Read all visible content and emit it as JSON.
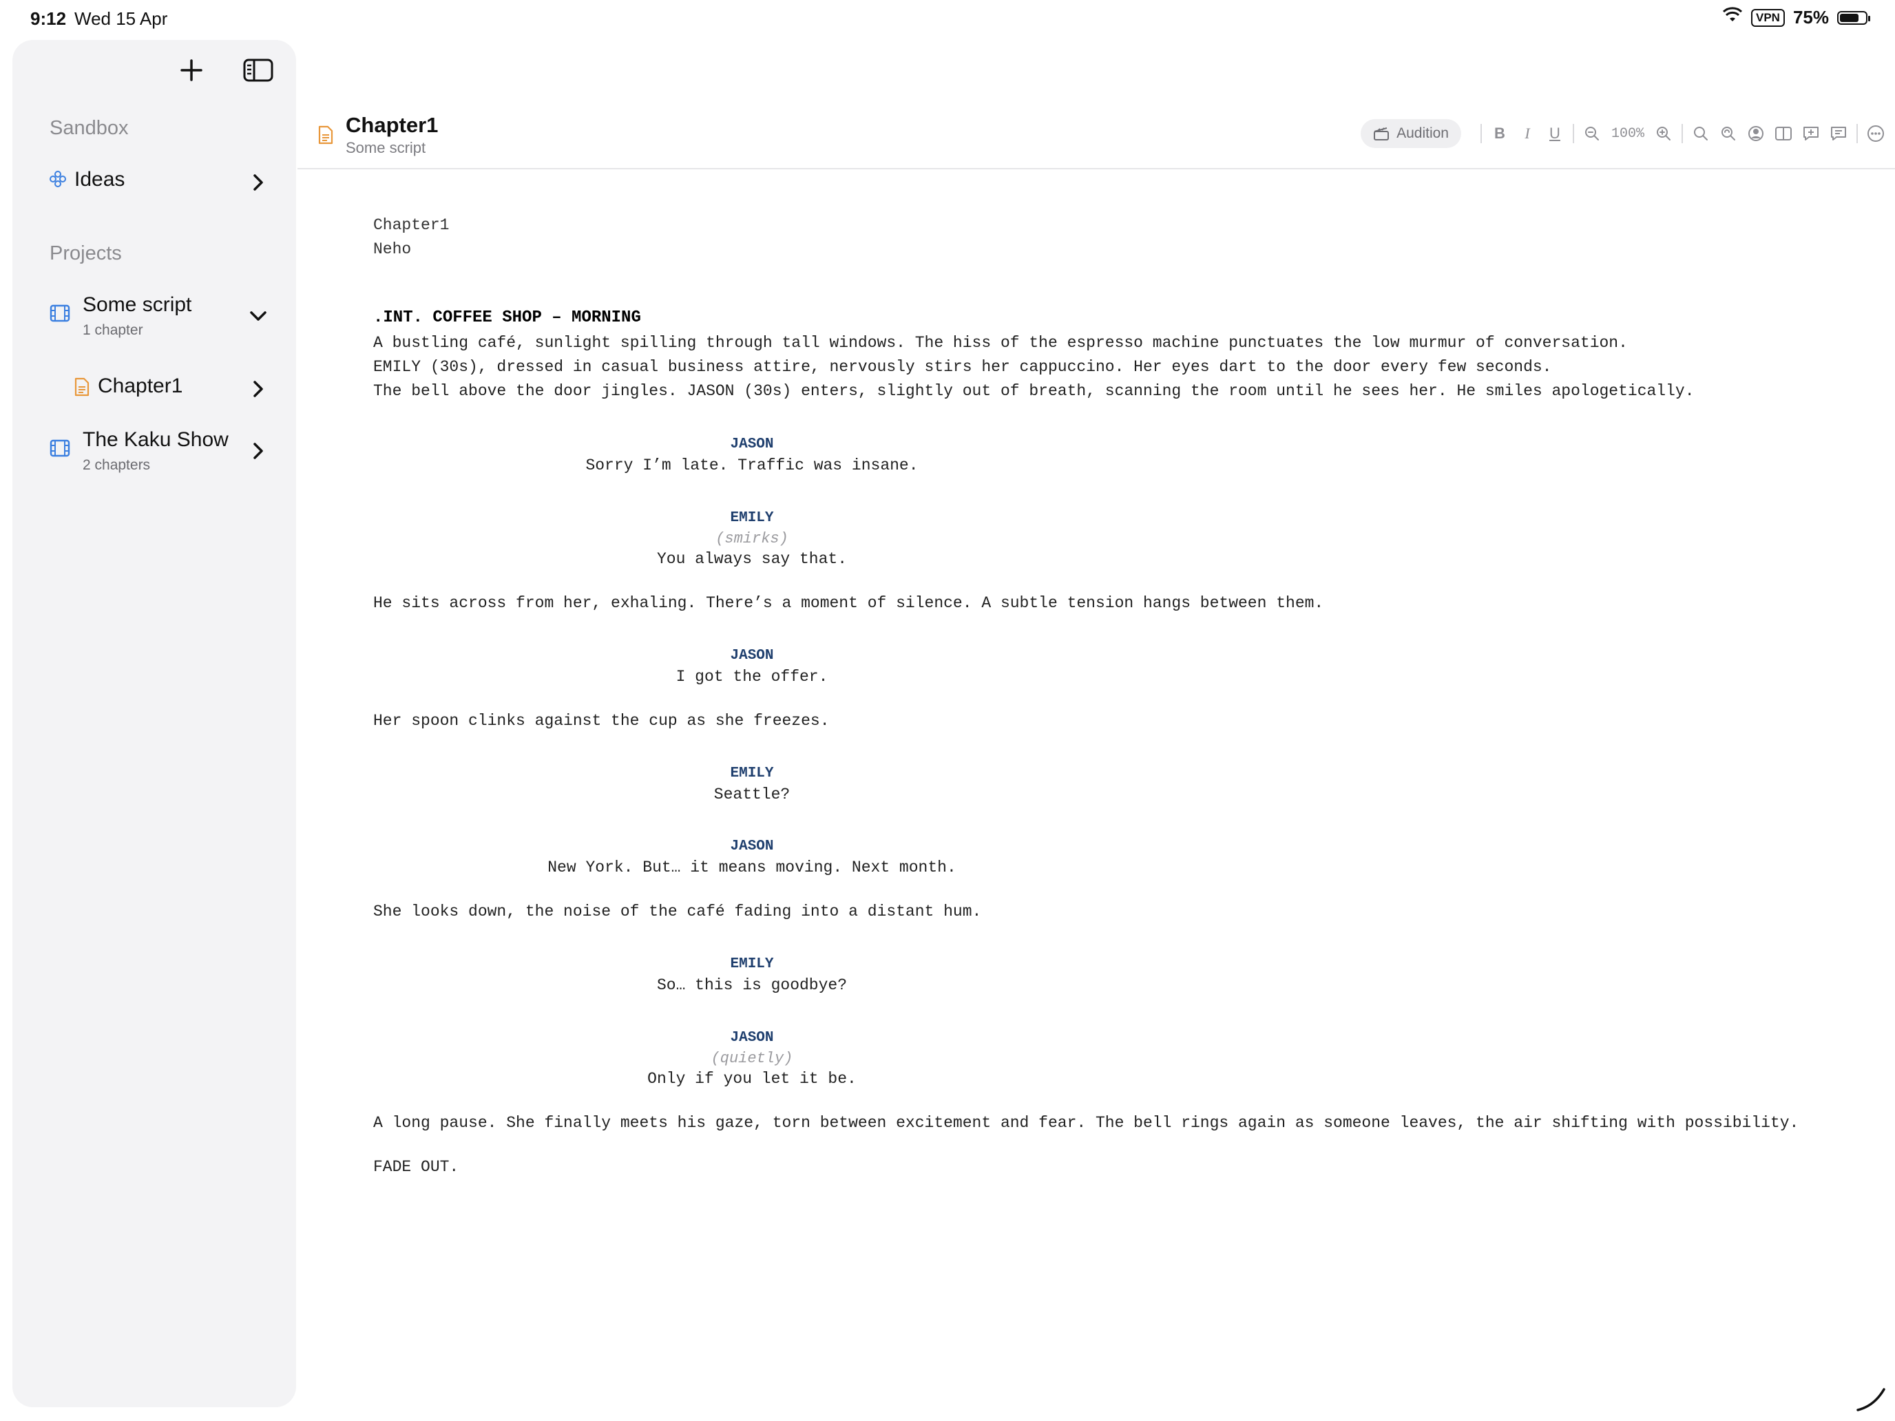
{
  "status_bar": {
    "time": "9:12",
    "date": "Wed 15 Apr",
    "vpn": "VPN",
    "battery": "75%",
    "battery_level": 0.75
  },
  "sidebar": {
    "sandbox_title": "Sandbox",
    "ideas_label": "Ideas",
    "projects_title": "Projects",
    "projects": [
      {
        "name": "Some script",
        "sub": "1 chapter",
        "chapter": "Chapter1"
      },
      {
        "name": "The Kaku Show",
        "sub": "2 chapters"
      }
    ]
  },
  "document": {
    "title": "Chapter1",
    "subtitle": "Some script"
  },
  "toolbar": {
    "audition_label": "Audition",
    "bold": "B",
    "italic": "I",
    "underline": "U",
    "zoom": "100%"
  },
  "script": {
    "title_lines": [
      "Chapter1",
      "Neho"
    ],
    "scene_heading": ".INT. COFFEE SHOP – MORNING",
    "action1": [
      "A bustling café, sunlight spilling through tall windows. The hiss of the espresso machine punctuates the low murmur of conversation.",
      "EMILY (30s), dressed in casual business attire, nervously stirs her cappuccino. Her eyes dart to the door every few seconds.",
      "The bell above the door jingles. JASON (30s) enters, slightly out of breath, scanning the room until he sees her. He smiles apologetically."
    ],
    "d1_char": "JASON",
    "d1_line": "Sorry I’m late. Traffic was insane.",
    "d2_char": "EMILY",
    "d2_paren": "(smirks)",
    "d2_line": "You always say that.",
    "action2": "He sits across from her, exhaling. There’s a moment of silence. A subtle tension hangs between them.",
    "d3_char": "JASON",
    "d3_line": "I got the offer.",
    "action3": "Her spoon clinks against the cup as she freezes.",
    "d4_char": "EMILY",
    "d4_line": "Seattle?",
    "d5_char": "JASON",
    "d5_line": "New York. But… it means moving. Next month.",
    "action4": "She looks down, the noise of the café fading into a distant hum.",
    "d6_char": "EMILY",
    "d6_line": "So… this is goodbye?",
    "d7_char": "JASON",
    "d7_paren": "(quietly)",
    "d7_line": "Only if you let it be.",
    "action5": "A long pause. She finally meets his gaze, torn between excitement and fear. The bell rings again as someone leaves, the air shifting with possibility.",
    "transition": "FADE OUT."
  },
  "colors": {
    "accent_blue": "#3b7fe0",
    "chapter_orange": "#e8973a",
    "character_name": "#1f3f6e"
  }
}
